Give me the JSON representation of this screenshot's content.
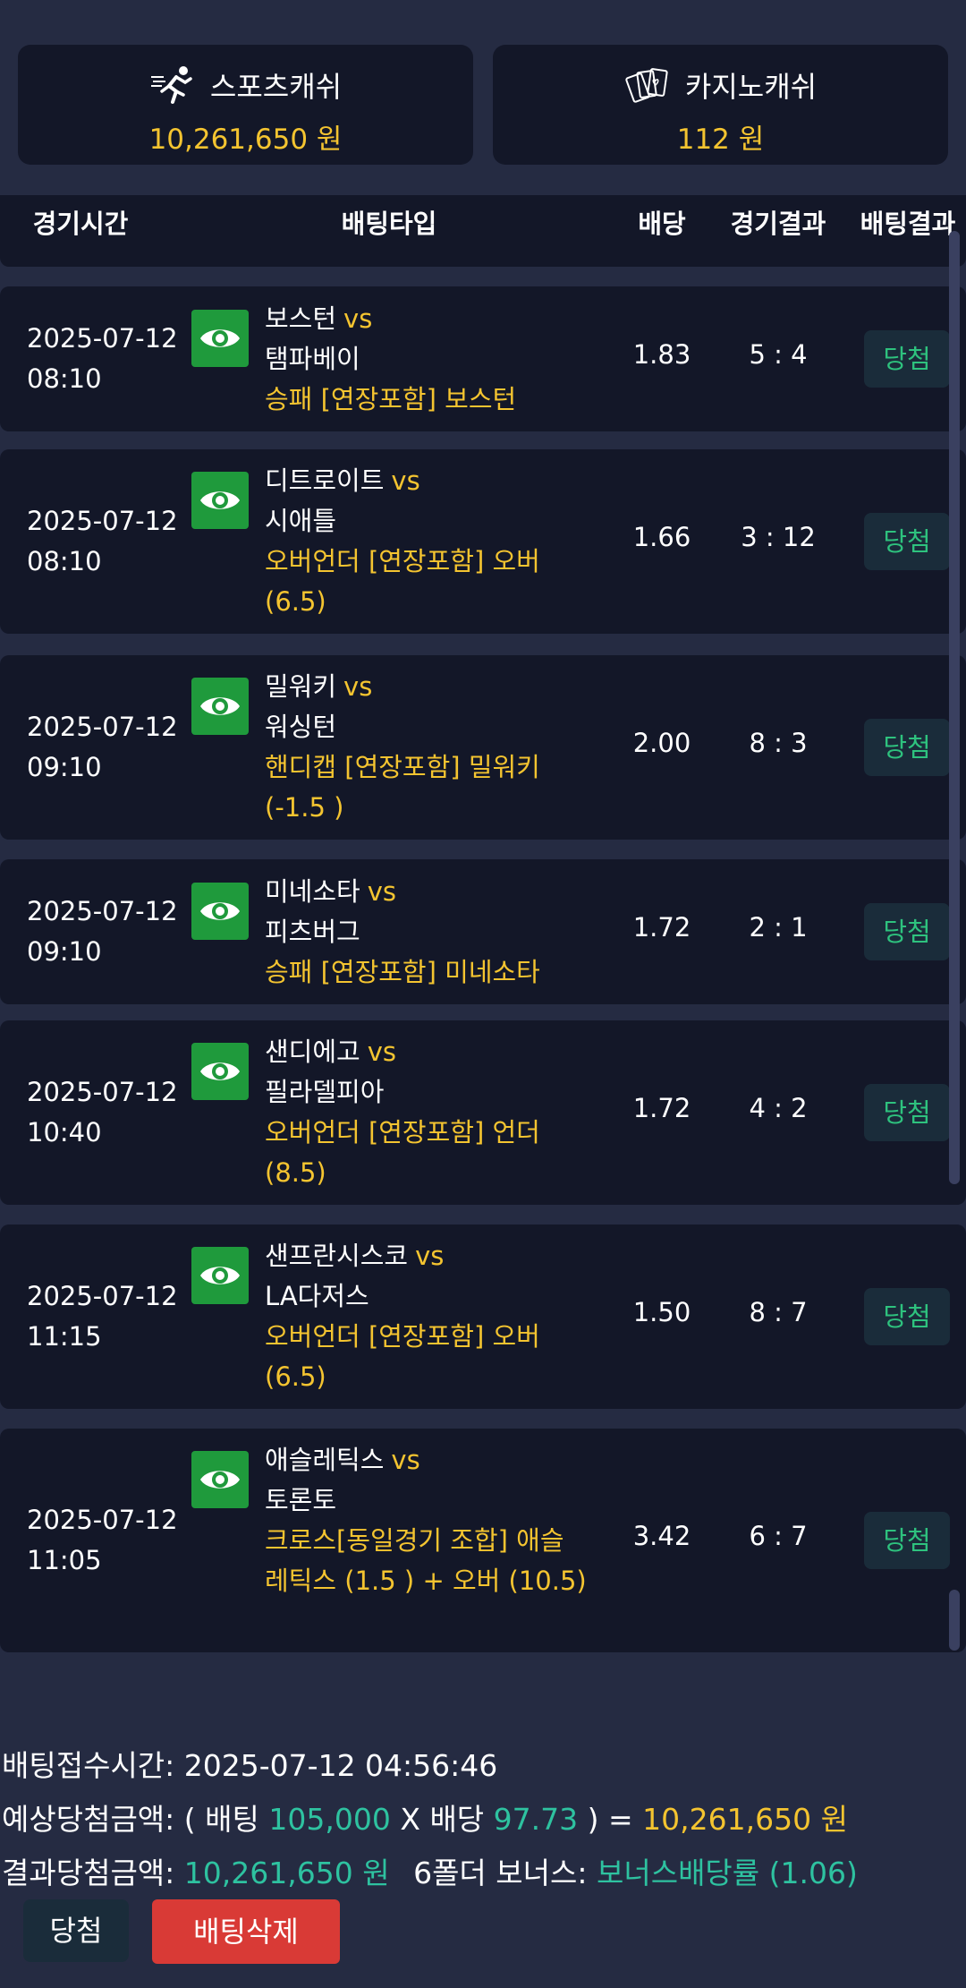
{
  "cash": {
    "sports": {
      "label": "스포츠캐쉬",
      "amount": "10,261,650 원",
      "icon": "running-icon"
    },
    "casino": {
      "label": "카지노캐쉬",
      "amount": "112 원",
      "icon": "cards-icon"
    }
  },
  "table": {
    "headers": {
      "time": "경기시간",
      "bet_type": "배팅타입",
      "odds": "배당",
      "score": "경기결과",
      "result": "배팅결과"
    },
    "rows": [
      {
        "time": "2025-07-12 08:10",
        "home": "보스턴",
        "vs": "vs",
        "away": "탬파베이",
        "market": "승패 [연장포함] 보스턴",
        "odds": "1.83",
        "score": "5 : 4",
        "result": "당첨"
      },
      {
        "time": "2025-07-12 08:10",
        "home": "디트로이트",
        "vs": "vs",
        "away": "시애틀",
        "market": "오버언더 [연장포함] 오버 (6.5)",
        "odds": "1.66",
        "score": "3 : 12",
        "result": "당첨"
      },
      {
        "time": "2025-07-12 09:10",
        "home": "밀워키",
        "vs": "vs",
        "away": "워싱턴",
        "market": "핸디캡 [연장포함] 밀워키 (-1.5 )",
        "odds": "2.00",
        "score": "8 : 3",
        "result": "당첨"
      },
      {
        "time": "2025-07-12 09:10",
        "home": "미네소타",
        "vs": "vs",
        "away": "피츠버그",
        "market": "승패 [연장포함] 미네소타",
        "odds": "1.72",
        "score": "2 : 1",
        "result": "당첨"
      },
      {
        "time": "2025-07-12 10:40",
        "home": "샌디에고",
        "vs": "vs",
        "away": "필라델피아",
        "market": "오버언더 [연장포함] 언더 (8.5)",
        "odds": "1.72",
        "score": "4 : 2",
        "result": "당첨"
      },
      {
        "time": "2025-07-12 11:15",
        "home": "샌프란시스코",
        "vs": "vs",
        "away": "LA다저스",
        "market": "오버언더 [연장포함] 오버 (6.5)",
        "odds": "1.50",
        "score": "8 : 7",
        "result": "당첨"
      },
      {
        "time": "2025-07-12 11:05",
        "home": "애슬레틱스",
        "vs": "vs",
        "away": "토론토",
        "market": "크로스[동일경기 조합] 애슬레틱스 (1.5 ) + 오버 (10.5)",
        "odds": "3.42",
        "score": "6 : 7",
        "result": "당첨"
      }
    ]
  },
  "summary": {
    "received_label": "배팅접수시간:",
    "received_value": "2025-07-12 04:56:46",
    "expected_label": "예상당첨금액:",
    "open_paren": "( 배팅",
    "stake": "105,000",
    "times": "X 배당",
    "total_odds": "97.73",
    "close_paren": ") =",
    "expected_amount": "10,261,650 원",
    "result_label": "결과당첨금액:",
    "result_amount": "10,261,650 원",
    "bonus_label": "6폴더 보너스:",
    "bonus_value": "보너스배당률 (1.06)"
  },
  "buttons": {
    "win": "당첨",
    "delete": "배팅삭제"
  }
}
